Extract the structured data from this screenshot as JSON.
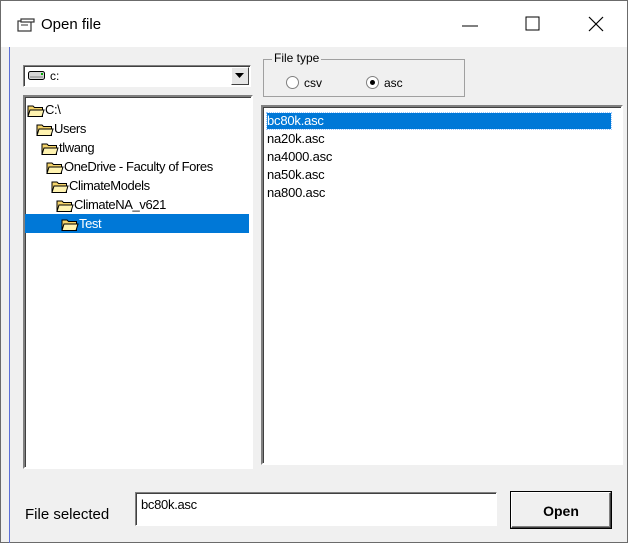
{
  "window": {
    "title": "Open file",
    "controls": {
      "minimize": "minimize",
      "maximize": "maximize",
      "close": "close"
    }
  },
  "drive": {
    "value": "c:"
  },
  "tree": [
    {
      "label": "C:\\",
      "indent": 0,
      "selected": false
    },
    {
      "label": "Users",
      "indent": 1,
      "selected": false
    },
    {
      "label": "tlwang",
      "indent": 2,
      "selected": false
    },
    {
      "label": "OneDrive - Faculty of Fores",
      "indent": 3,
      "selected": false
    },
    {
      "label": "ClimateModels",
      "indent": 4,
      "selected": false
    },
    {
      "label": "ClimateNA_v621",
      "indent": 5,
      "selected": false
    },
    {
      "label": "Test",
      "indent": 6,
      "selected": true
    }
  ],
  "file_type": {
    "legend": "File type",
    "options": [
      {
        "label": "csv",
        "checked": false
      },
      {
        "label": "asc",
        "checked": true
      }
    ]
  },
  "files": [
    {
      "name": "bc80k.asc",
      "selected": true
    },
    {
      "name": "na20k.asc",
      "selected": false
    },
    {
      "name": "na4000.asc",
      "selected": false
    },
    {
      "name": "na50k.asc",
      "selected": false
    },
    {
      "name": "na800.asc",
      "selected": false
    }
  ],
  "footer": {
    "selected_label": "File selected",
    "selected_value": "bc80k.asc",
    "open_label": "Open"
  },
  "colors": {
    "selection": "#0078d7",
    "dialog_bg": "#f0f0f0"
  }
}
